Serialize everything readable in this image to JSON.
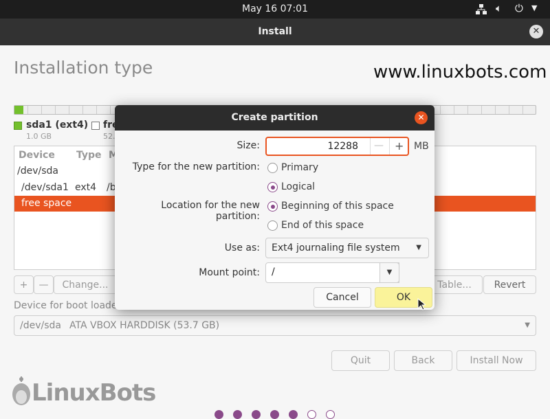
{
  "topbar": {
    "datetime": "May 16  07:01",
    "icons": [
      "network-icon",
      "volume-icon",
      "power-icon",
      "chevron-down-icon"
    ]
  },
  "window": {
    "title": "Install"
  },
  "page": {
    "title": "Installation type",
    "watermark": "www.linuxbots.com"
  },
  "disk_bar": {
    "used_fraction": 0.019,
    "colors": {
      "used": "#73c02c"
    }
  },
  "legend": [
    {
      "name": "sda1 (ext4)",
      "size": "1.0 GB",
      "color": "#73c02c"
    },
    {
      "name": "free space",
      "visible_name": "fre",
      "size": "52.",
      "color": "#ffffff"
    }
  ],
  "table": {
    "headers": [
      "Device",
      "Type",
      "M"
    ],
    "rows": [
      [
        "/dev/sda",
        "",
        ""
      ],
      [
        "/dev/sda1",
        "ext4",
        "/b"
      ],
      [
        "free space",
        "",
        ""
      ]
    ],
    "selected_row": 2,
    "selected_color": "#e95420"
  },
  "table_buttons": {
    "add": "+",
    "remove": "—",
    "change": "Change...",
    "new_table": "Table...",
    "revert": "Revert"
  },
  "bootloader": {
    "label": "Device for boot loade",
    "device": "/dev/sda",
    "description": "ATA VBOX HARDDISK (53.7 GB)"
  },
  "nav": {
    "quit": "Quit",
    "back": "Back",
    "install": "Install Now"
  },
  "logo": "LinuxBots",
  "progress_dots": {
    "filled": 5,
    "total": 7,
    "color": "#8a4a8a"
  },
  "dialog": {
    "title": "Create partition",
    "size_label": "Size:",
    "size_value": "12288",
    "size_unit": "MB",
    "minus": "—",
    "plus": "+",
    "type_label": "Type for the new partition:",
    "type_options": [
      "Primary",
      "Logical"
    ],
    "type_selected": "Logical",
    "location_label": "Location for the new partition:",
    "location_options": [
      "Beginning of this space",
      "End of this space"
    ],
    "location_selected": "Beginning of this space",
    "useas_label": "Use as:",
    "useas_value": "Ext4 journaling file system",
    "mount_label": "Mount point:",
    "mount_value": "/",
    "cancel": "Cancel",
    "ok": "OK"
  }
}
